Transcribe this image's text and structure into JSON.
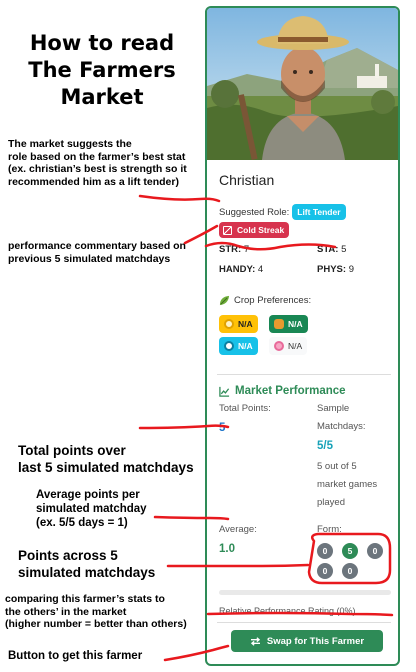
{
  "guide": {
    "title_lines": [
      "How to read",
      "The Farmers",
      "Market"
    ],
    "notes": {
      "role_note": [
        "The market suggests the",
        "role based on the farmer’s best stat",
        "(ex. christian’s best is strength so it",
        "recommended him as a lift tender)"
      ],
      "commentary_note": [
        "performance commentary based on",
        "previous 5 simulated matchdays"
      ],
      "total_note": [
        "Total points over",
        "last 5 simulated matchdays"
      ],
      "average_note": [
        "Average points per",
        "simulated matchday",
        "(ex. 5/5 days = 1)"
      ],
      "points_note": [
        "Points across 5",
        "simulated matchdays"
      ],
      "compare_note": [
        "comparing this farmer’s stats to",
        "the others’ in the market",
        "(higher number = better than others)"
      ],
      "button_note": "Button to get this farmer"
    },
    "annotation_color": "#e8191e"
  },
  "farmer": {
    "name": "Christian",
    "suggested_role_label": "Suggested Role:",
    "suggested_role": "Lift Tender",
    "commentary": "Cold Streak",
    "stats": {
      "str_label": "STR:",
      "str": "7",
      "sta_label": "STA:",
      "sta": "5",
      "handy_label": "HANDY:",
      "handy": "4",
      "phys_label": "PHYS:",
      "phys": "9"
    },
    "crop_preferences_label": "Crop Preferences:",
    "crops": [
      {
        "icon": "sun-icon",
        "value": "N/A",
        "color": "#ffc107"
      },
      {
        "icon": "wheat-icon",
        "value": "N/A",
        "color": "#198754"
      },
      {
        "icon": "snowflake-icon",
        "value": "N/A",
        "color": "#17c1e8"
      },
      {
        "icon": "flower-icon",
        "value": "N/A",
        "color": "#f8f9fa"
      }
    ]
  },
  "performance": {
    "heading": "Market Performance",
    "total_points_label": "Total Points:",
    "total_points": "5",
    "sample_label": [
      "Sample",
      "Matchdays:"
    ],
    "sample_value": "5/5",
    "sample_note": [
      "5 out of 5",
      "market games",
      "played"
    ],
    "average_label": "Average:",
    "average": "1.0",
    "form_label": "Form:",
    "form": [
      "0",
      "5",
      "0",
      "0",
      "0"
    ],
    "relative_rating_label": "Relative Performance Rating (0%)",
    "relative_rating": 0,
    "swap_button": "Swap for This Farmer"
  },
  "colors": {
    "accent": "#2e8b57",
    "role_badge": "#17c1e8",
    "streak_badge": "#d7334e",
    "form_good": "#2e8b57",
    "form_zero": "#6c757d",
    "link_blue": "#1a73c9",
    "teal_value": "#17a2b8"
  }
}
